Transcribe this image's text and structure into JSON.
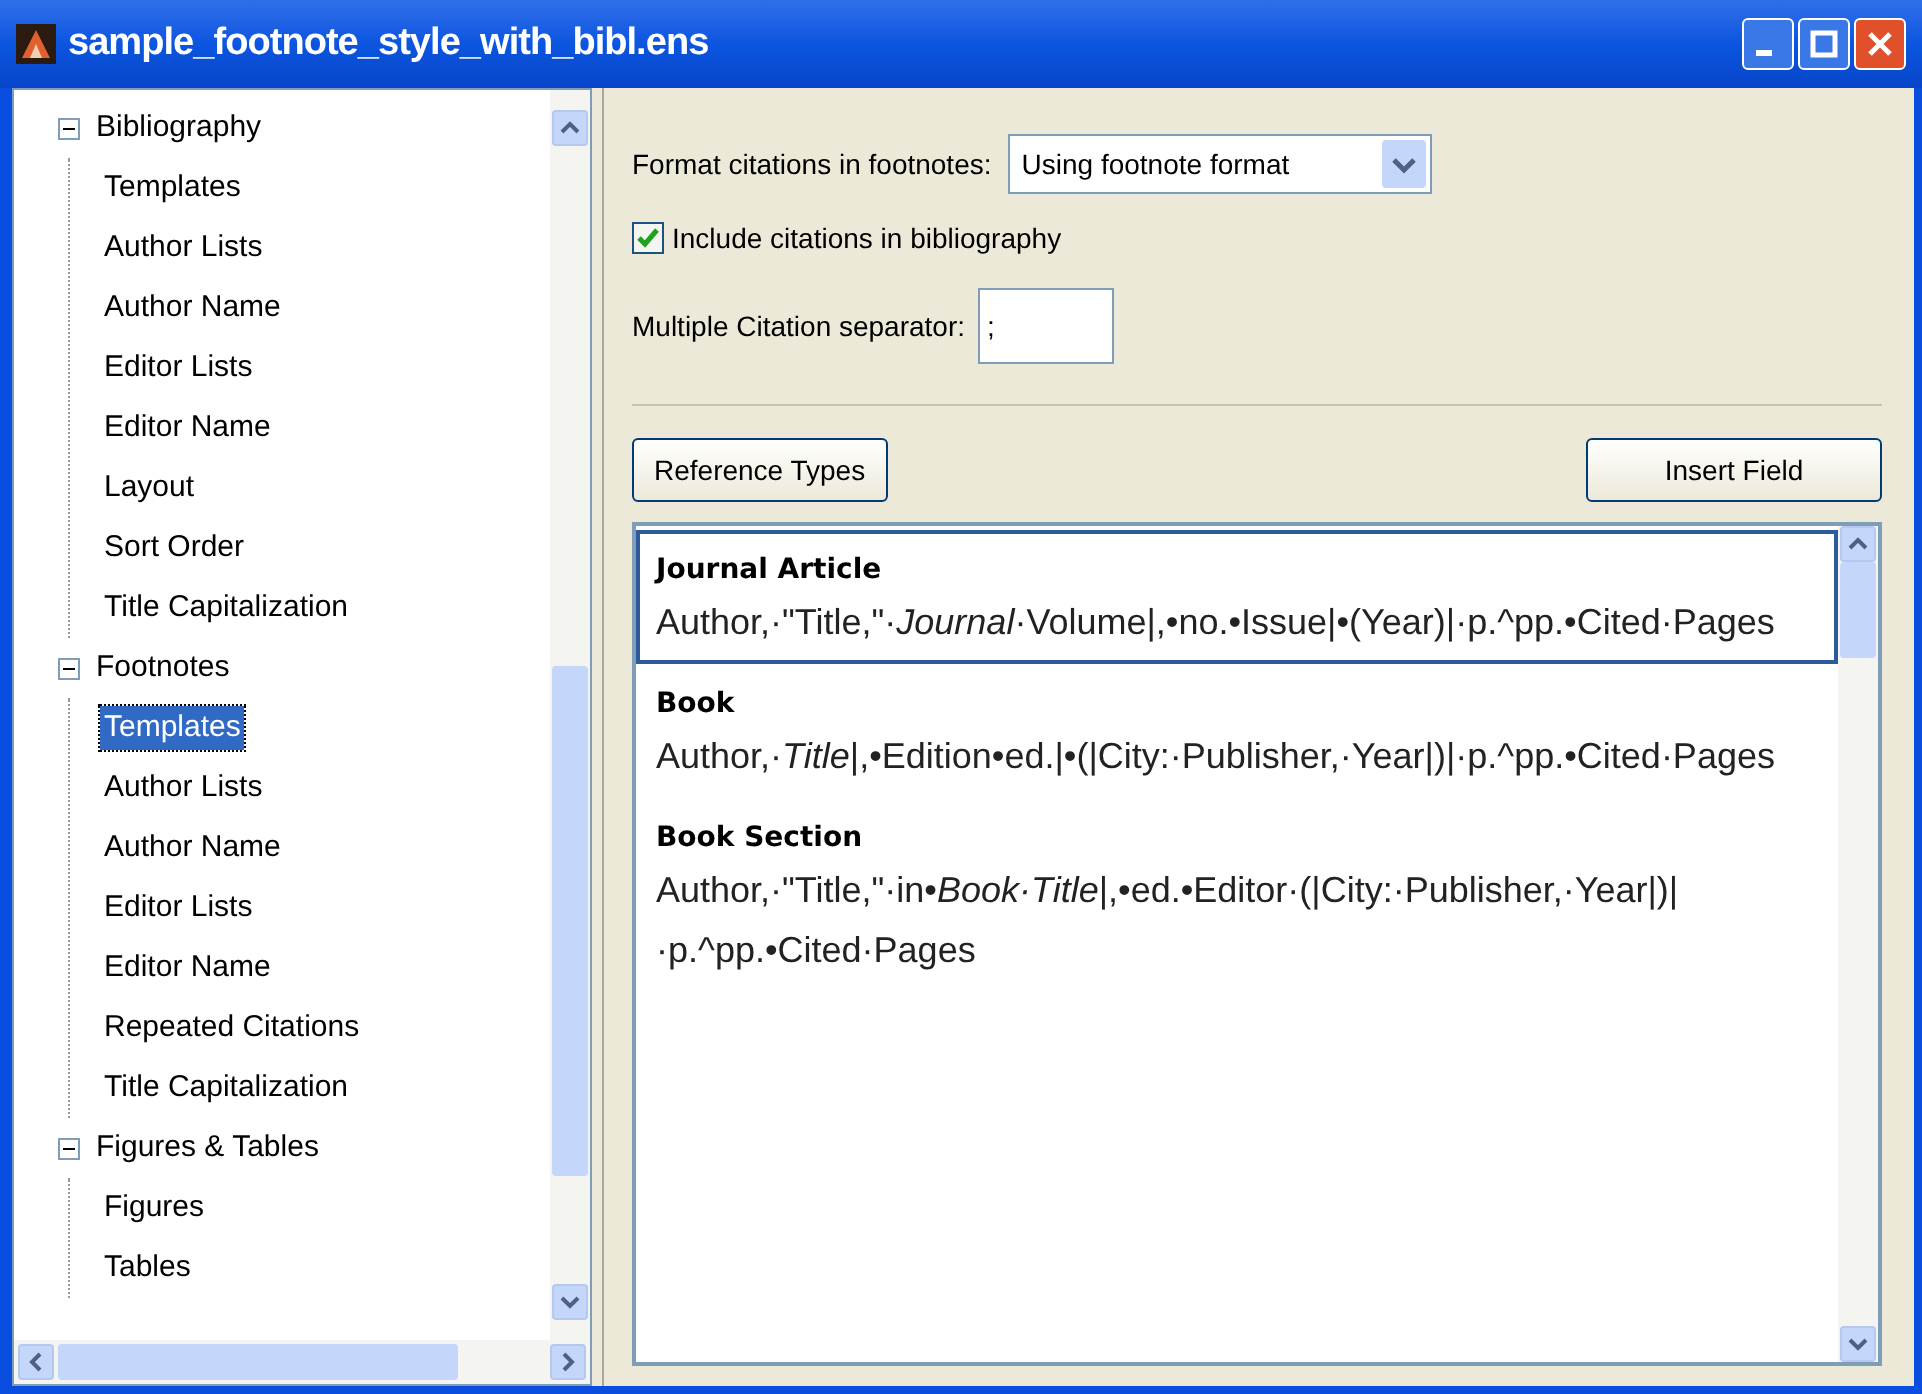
{
  "window": {
    "title": "sample_footnote_style_with_bibl.ens"
  },
  "tree": [
    {
      "label": "Bibliography",
      "expanded": true,
      "selected": false,
      "children": [
        {
          "label": "Templates",
          "selected": false
        },
        {
          "label": "Author Lists",
          "selected": false
        },
        {
          "label": "Author Name",
          "selected": false
        },
        {
          "label": "Editor Lists",
          "selected": false
        },
        {
          "label": "Editor Name",
          "selected": false
        },
        {
          "label": "Layout",
          "selected": false
        },
        {
          "label": "Sort Order",
          "selected": false
        },
        {
          "label": "Title Capitalization",
          "selected": false
        }
      ]
    },
    {
      "label": "Footnotes",
      "expanded": true,
      "selected": false,
      "children": [
        {
          "label": "Templates",
          "selected": true
        },
        {
          "label": "Author Lists",
          "selected": false
        },
        {
          "label": "Author Name",
          "selected": false
        },
        {
          "label": "Editor Lists",
          "selected": false
        },
        {
          "label": "Editor Name",
          "selected": false
        },
        {
          "label": "Repeated Citations",
          "selected": false
        },
        {
          "label": "Title Capitalization",
          "selected": false
        }
      ]
    },
    {
      "label": "Figures & Tables",
      "expanded": true,
      "selected": false,
      "children": [
        {
          "label": "Figures",
          "selected": false
        },
        {
          "label": "Tables",
          "selected": false
        }
      ]
    }
  ],
  "format": {
    "label": "Format citations in footnotes:",
    "value": "Using footnote format"
  },
  "include": {
    "label": "Include citations in bibliography",
    "checked": true
  },
  "separator": {
    "label": "Multiple Citation separator:",
    "value": ";"
  },
  "buttons": {
    "reference_types": "Reference Types",
    "insert_field": "Insert Field"
  },
  "templates": [
    {
      "type": "Journal Article",
      "selected": true,
      "text": "Author,·\"Title,\"·*Journal*·Volume|,•no.•Issue|•(Year)|·p.^pp.•Cited·Pages"
    },
    {
      "type": "Book",
      "selected": false,
      "text": "Author,·*Title*|,•Edition•ed.|•(|City:·Publisher,·Year|)|·p.^pp.•Cited·Pages"
    },
    {
      "type": "Book Section",
      "selected": false,
      "text": "Author,·\"Title,\"·in•*Book·Title*|,•ed.•Editor·(|City:·Publisher,·Year|)|·p.^pp.•Cited·Pages"
    }
  ]
}
